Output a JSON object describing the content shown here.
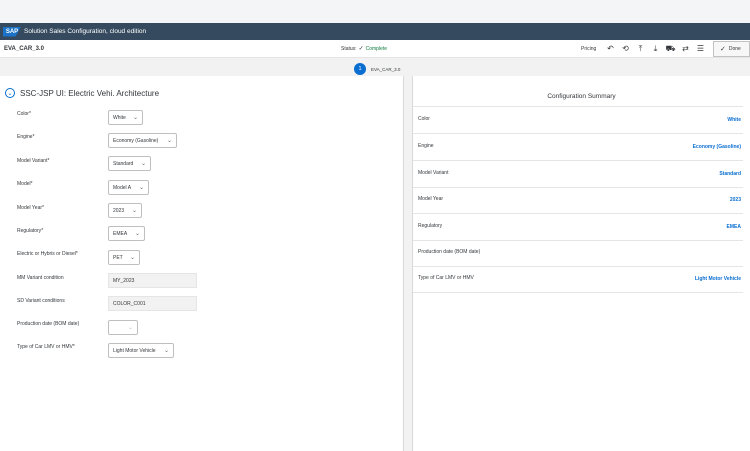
{
  "shell": {
    "logo_text": "SAP",
    "title": "Solution Sales Configuration, cloud edition"
  },
  "header": {
    "object_title": "EVA_CAR_3.0",
    "status_label": "Status:",
    "status_value": "Complete",
    "pricing_label": "Pricing",
    "done_label": "Done"
  },
  "stepbar": {
    "step_number": "1",
    "step_label": "EVA_CAR_3.0"
  },
  "section": {
    "title": "SSC-JSP UI: Electric Vehi. Architecture"
  },
  "required_marker": "*",
  "fields": [
    {
      "label": "Color",
      "value": "White"
    },
    {
      "label": "Engine",
      "value": "Economy (Gasoline)"
    },
    {
      "label": "Model Variant",
      "value": "Standard"
    },
    {
      "label": "Model",
      "value": "Model A"
    },
    {
      "label": "Model Year",
      "value": "2023"
    },
    {
      "label": "Regulatory",
      "value": "EMEA"
    },
    {
      "label": "Electric or Hybris or Diesel",
      "value": "PET"
    },
    {
      "label": "MM Variant condition",
      "value": "MY_2023"
    },
    {
      "label": "SD Variant conditions",
      "value": "COLOR_C001"
    },
    {
      "label": "Production date (BOM date)",
      "value": ""
    },
    {
      "label": "Type of Car LMV or HMV",
      "value": "Light Motor Vehicle"
    }
  ],
  "summary": {
    "title": "Configuration Summary",
    "rows": [
      {
        "label": "Color",
        "value": "White"
      },
      {
        "label": "Engine",
        "value": "Economy (Gasoline)"
      },
      {
        "label": "Model Variant",
        "value": "Standard"
      },
      {
        "label": "Model Year",
        "value": "2023"
      },
      {
        "label": "Regulatory",
        "value": "EMEA"
      },
      {
        "label": "Production date (BOM date)",
        "value": ""
      },
      {
        "label": "Type of Car LMV or HMV",
        "value": "Light Motor Vehicle"
      }
    ]
  },
  "colors": {
    "shell_bg": "#354a5f",
    "accent": "#0a6ed1",
    "status_green": "#107e3e"
  },
  "icons": [
    "undo-icon",
    "reset-icon",
    "upload-icon",
    "download-icon",
    "car-icon",
    "compare-icon",
    "summary-icon",
    "check-icon"
  ]
}
